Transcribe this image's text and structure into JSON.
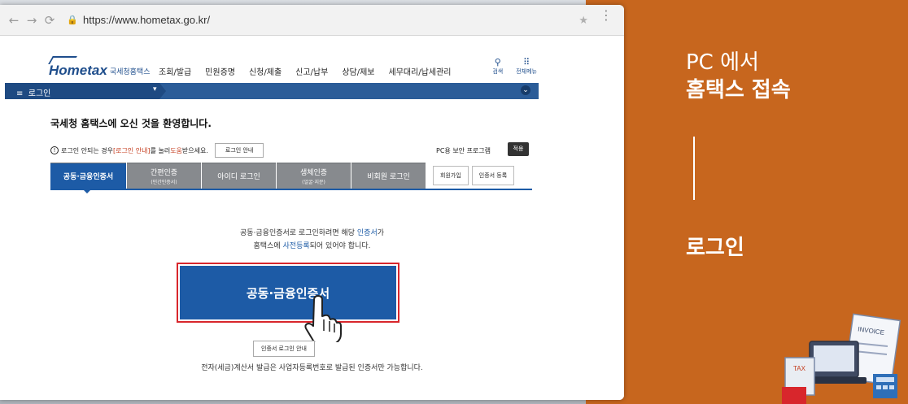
{
  "browser": {
    "url": "https://www.hometax.go.kr/"
  },
  "site": {
    "logo_text": "Hometax",
    "logo_sub": "국세청홈택스",
    "menu": [
      "조회/발급",
      "민원증명",
      "신청/제출",
      "신고/납부",
      "상담/제보",
      "세무대리/납세관리"
    ],
    "util_search": "검색",
    "util_allmenu": "전체메뉴",
    "breadcrumb": "로그인",
    "welcome": "국세청 홈택스에 오신 것을 환영합니다.",
    "help_prefix": "로그인 안되는 경우 ",
    "help_highlight1": "[로그인 안내]",
    "help_middle": "를 눌러 ",
    "help_highlight2": "도움",
    "help_suffix": "받으세요.",
    "help_button": "로그인 안내",
    "security_program": "PC용 보안 프로그램",
    "apply_button": "적용",
    "tabs": [
      {
        "label": "공동·금융인증서",
        "sub": ""
      },
      {
        "label": "간편인증",
        "sub": "(민간인증서)"
      },
      {
        "label": "아이디 로그인",
        "sub": ""
      },
      {
        "label": "생체인증",
        "sub": "(얼굴·지문)"
      },
      {
        "label": "비회원 로그인",
        "sub": ""
      }
    ],
    "signup_button": "회원가입",
    "cert_register_button": "인증서 등록",
    "desc_line1_a": "공동·금융인증서로 로그인하려면 해당 ",
    "desc_line1_hl": "인증서",
    "desc_line1_b": "가",
    "desc_line2_a": "홈택스에 ",
    "desc_line2_hl": "사전등록",
    "desc_line2_b": "되어 있어야 합니다.",
    "cert_button": "공동·금융인증서",
    "cert_guide_button": "인증서 로그인 안내",
    "bottom_note": "전자(세금)계산서 발급은 사업자등록번호로 발급된 인증서만 가능합니다."
  },
  "panel": {
    "title_line1": "PC 에서",
    "title_line2": "홈택스 접속",
    "subtitle": "로그인",
    "deco_invoice": "INVOICE",
    "deco_tax": "TAX"
  },
  "colors": {
    "panel_bg": "#c7661e",
    "hometax_blue": "#1d5ba6",
    "highlight_red": "#d8262c"
  }
}
